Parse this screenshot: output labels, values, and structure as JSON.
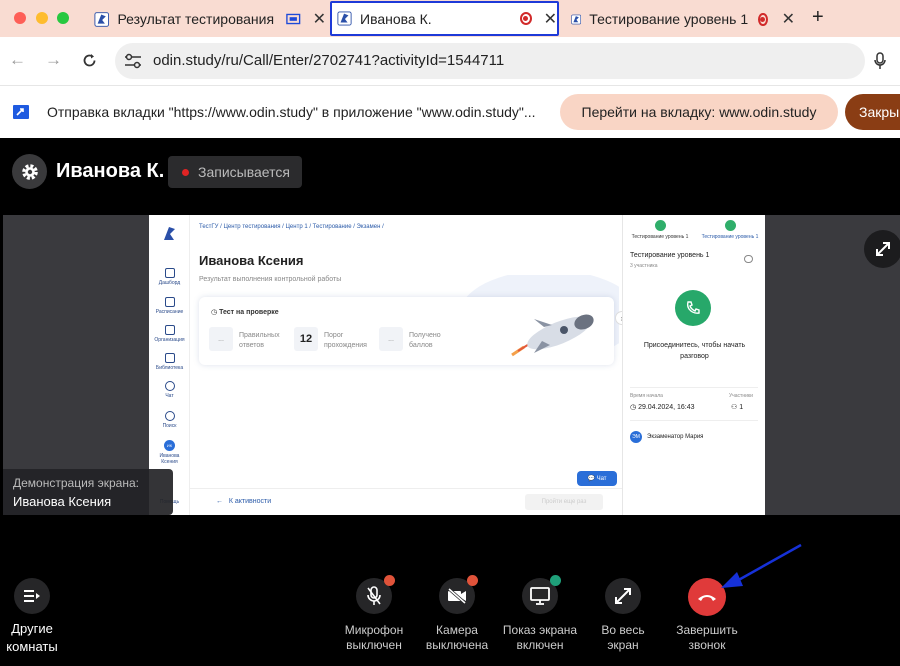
{
  "browser": {
    "tabs": [
      {
        "title": "Результат тестирования",
        "active": false
      },
      {
        "title": "Иванова К.",
        "active": true
      },
      {
        "title": "Тестирование уровень 1",
        "active": false
      }
    ],
    "new_tab": "+",
    "url": "odin.study/ru/Call/Enter/2702741?activityId=1544711"
  },
  "infobar": {
    "message": "Отправка вкладки \"https://www.odin.study\" в приложение \"www.odin.study\"...",
    "goto_button": "Перейти на вкладку: www.odin.study",
    "close_button": "Закры"
  },
  "call": {
    "participant_name": "Иванова К.",
    "recording_label": "Записывается",
    "demo_label": "Демонстрация экрана:",
    "demo_name": "Иванова Ксения"
  },
  "shared_screen": {
    "breadcrumb": "ТестГУ  /  Центр тестирования  /  Центр 1  /  Тестирование  /  Экзамен  /",
    "title": "Иванова Ксения",
    "subtitle": "Результат выполнения контрольной работы",
    "status": "Тест на проверке",
    "correct_value": "...",
    "correct_label_1": "Правильных",
    "correct_label_2": "ответов",
    "threshold_value": "12",
    "threshold_label_1": "Порог",
    "threshold_label_2": "прохождения",
    "score_value": "...",
    "score_label_1": "Получено",
    "score_label_2": "баллов",
    "nav": [
      "Дашборд",
      "Расписание",
      "Организация",
      "Библиотека",
      "Чат",
      "Поиск"
    ],
    "nav_user_initials": "ИК",
    "nav_user_1": "Иванова",
    "nav_user_2": "Ксения",
    "nav_help": "Помощь",
    "back_link": "К активности",
    "retry_button": "Пройти еще раз",
    "chat_button": "Чат",
    "right_panel": {
      "tab1": "Тестирование уровень 1",
      "tab2": "Тестирование уровень 1",
      "call_title": "Тестирование уровень 1",
      "participants_count_text": "3 участника",
      "join_text_1": "Присоединитесь, чтобы начать",
      "join_text_2": "разговор",
      "start_time_label": "Время начала",
      "start_time": "29.04.2024, 16:43",
      "participants_label": "Участники",
      "participants": "1",
      "examiner_initials": "ЭМ",
      "examiner": "Экзаменатор Мария"
    }
  },
  "controls": {
    "other_rooms_1": "Другие",
    "other_rooms_2": "комнаты",
    "mic_1": "Микрофон",
    "mic_2": "выключен",
    "camera_1": "Камера",
    "camera_2": "выключена",
    "screen_1": "Показ экрана",
    "screen_2": "включен",
    "fullscreen_1": "Во весь",
    "fullscreen_2": "экран",
    "end_1": "Завершить",
    "end_2": "звонок"
  },
  "colors": {
    "tabbar_bg": "#f9dcd2",
    "active_tab_border": "#1e3ad8",
    "end_call": "#e03a3a",
    "badge_red": "#e0533a",
    "badge_green": "#1fa07a",
    "annotation_arrow": "#1631d8"
  }
}
